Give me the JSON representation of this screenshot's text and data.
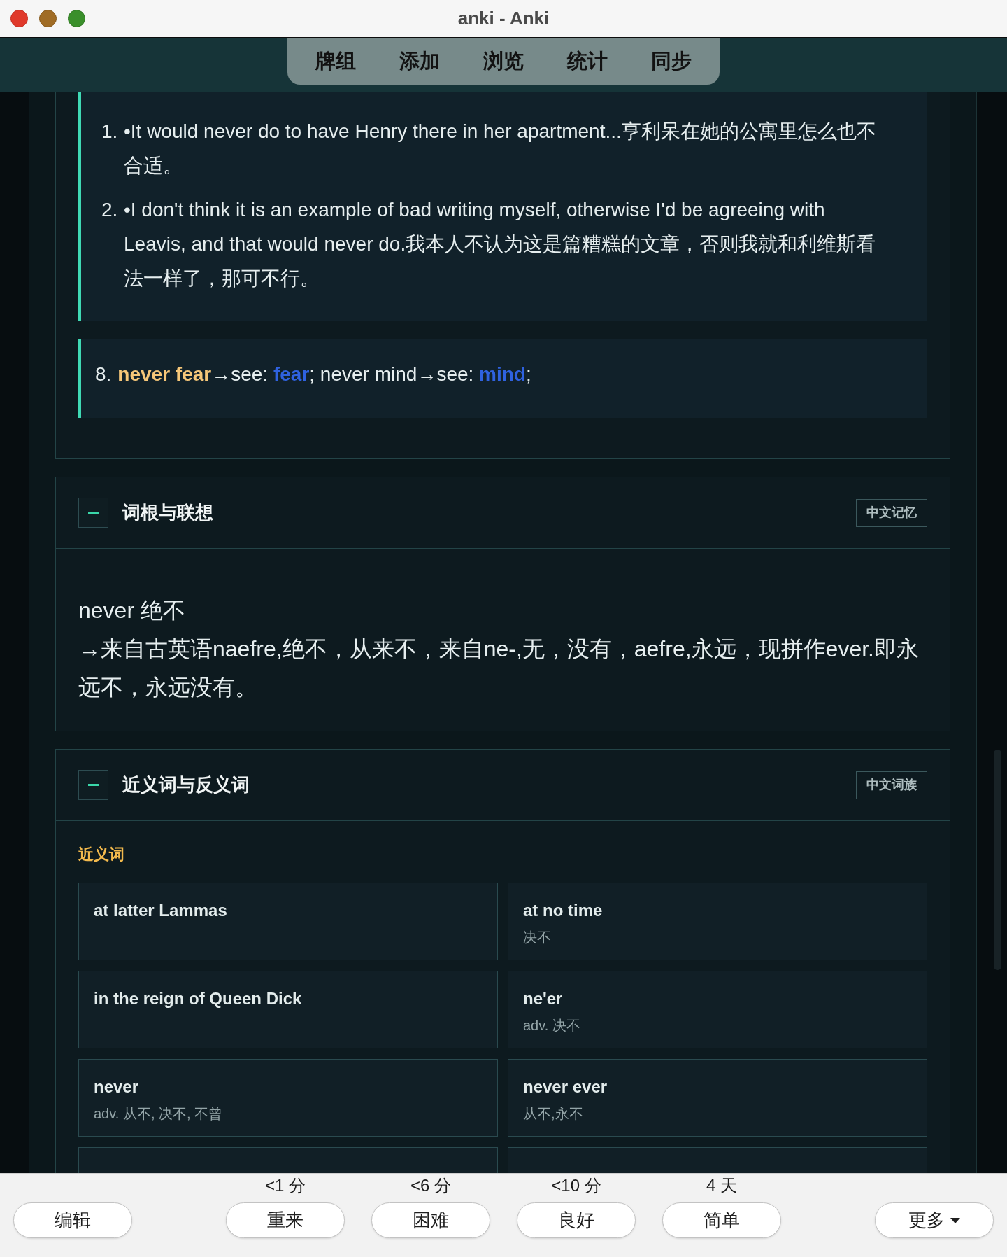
{
  "window": {
    "title": "anki - Anki"
  },
  "toolbar": {
    "items": [
      "牌组",
      "添加",
      "浏览",
      "统计",
      "同步"
    ]
  },
  "definition_card": {
    "examples": [
      {
        "number": "1.",
        "text": "•It would never do to have Henry there in her apartment...亨利呆在她的公寓里怎么也不合适。"
      },
      {
        "number": "2.",
        "text": "•I don't think it is an example of bad writing myself, otherwise I'd be agreeing with Leavis, and that would never do.我本人不认为这是篇糟糕的文章，否则我就和利维斯看法一样了，那可不行。"
      }
    ],
    "note": {
      "number": "8.",
      "segments": [
        {
          "kind": "headword",
          "text": "never fear"
        },
        {
          "kind": "plain",
          "text": "→see: "
        },
        {
          "kind": "link",
          "text": "fear"
        },
        {
          "kind": "plain",
          "text": "; never mind→see: "
        },
        {
          "kind": "link",
          "text": "mind"
        },
        {
          "kind": "plain",
          "text": ";"
        }
      ]
    }
  },
  "sections": [
    {
      "kind": "text",
      "title": "词根与联想",
      "tag": "中文记忆",
      "expanded": true,
      "paragraphs": [
        "never 绝不",
        "→来自古英语naefre,绝不，从来不，来自ne-,无，没有，aefre,永远，现拼作ever.即永远不，永远没有。"
      ]
    },
    {
      "kind": "synonyms",
      "title": "近义词与反义词",
      "tag": "中文词族",
      "expanded": true,
      "group_label": "近义词",
      "items": [
        {
          "word": "at latter Lammas"
        },
        {
          "word": "at no time",
          "meaning": "决不"
        },
        {
          "word": "in the reign of Queen Dick"
        },
        {
          "word": "ne'er",
          "meaning": "adv. 决不"
        },
        {
          "word": "never",
          "meaning": "adv. 从不, 决不, 不曾"
        },
        {
          "word": "never ever",
          "meaning": "从不,永不"
        }
      ]
    }
  ],
  "review_bar": {
    "edit_button": "编辑",
    "answers": [
      {
        "interval": "<1 分",
        "label": "重来"
      },
      {
        "interval": "<6 分",
        "label": "困难"
      },
      {
        "interval": "<10 分",
        "label": "良好"
      },
      {
        "interval": "4 天",
        "label": "简单"
      }
    ],
    "more_button": "更多"
  }
}
